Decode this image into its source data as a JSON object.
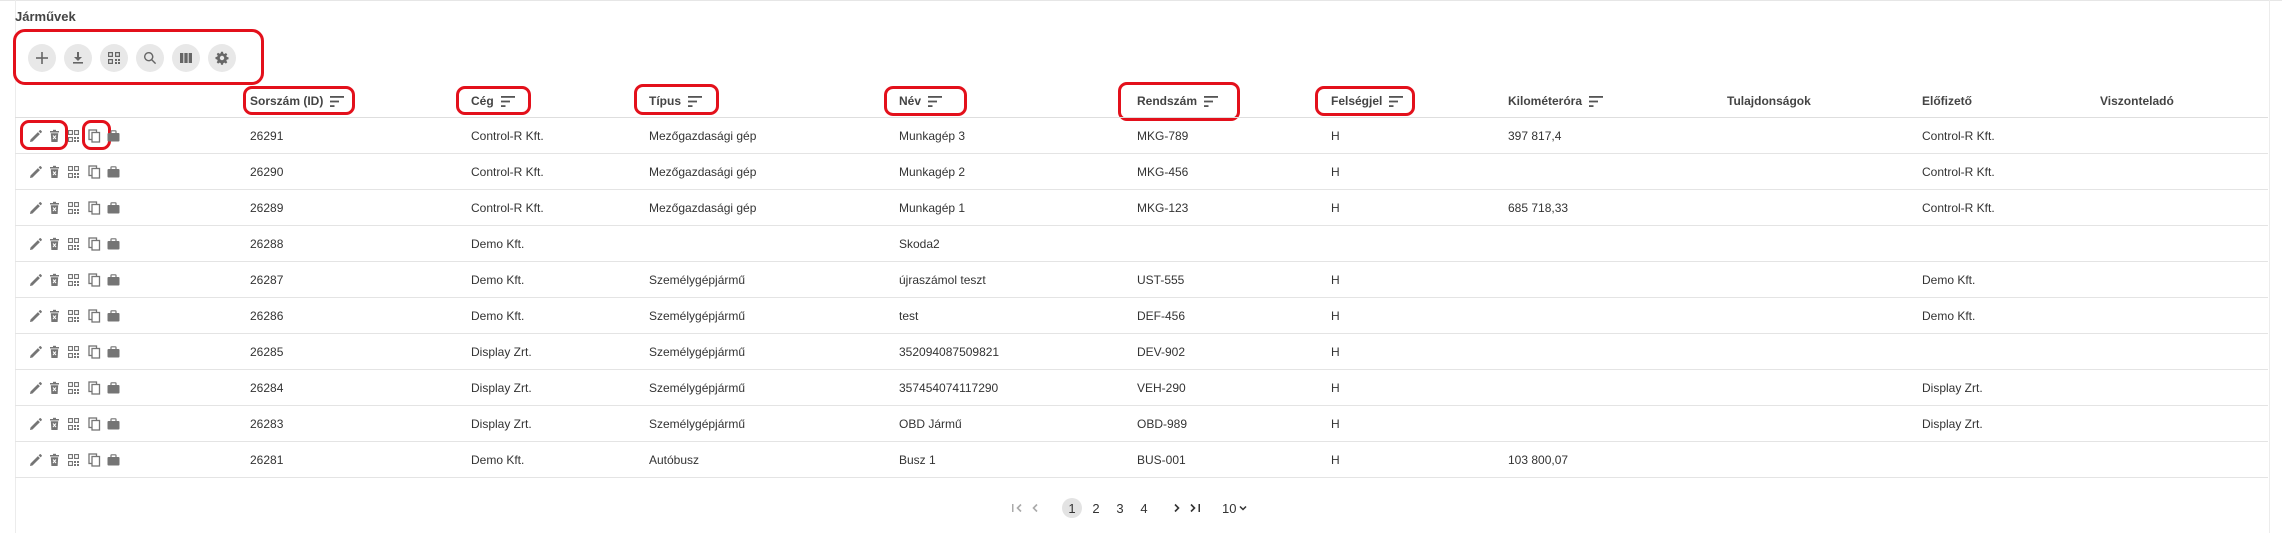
{
  "page": {
    "title": "Járművek"
  },
  "toolbar": {
    "buttons": [
      {
        "name": "add-button",
        "icon": "plus-icon"
      },
      {
        "name": "download-button",
        "icon": "download-icon"
      },
      {
        "name": "qr-button",
        "icon": "qr-code-icon"
      },
      {
        "name": "search-button",
        "icon": "search-icon"
      },
      {
        "name": "columns-button",
        "icon": "view-columns-icon"
      },
      {
        "name": "settings-button",
        "icon": "gear-icon"
      }
    ]
  },
  "columns": {
    "id": "Sorszám (ID)",
    "company": "Cég",
    "type": "Típus",
    "name": "Név",
    "plate": "Rendszám",
    "country": "Felségjel",
    "odometer": "Kilométeróra",
    "properties": "Tulajdonságok",
    "subscriber": "Előfizető",
    "reseller": "Viszonteladó"
  },
  "rows": [
    {
      "id": "26291",
      "company": "Control-R Kft.",
      "type": "Mezőgazdasági gép",
      "name": "Munkagép 3",
      "plate": "MKG-789",
      "country": "H",
      "odometer": "397 817,4",
      "properties": "",
      "subscriber": "Control-R Kft.",
      "reseller": ""
    },
    {
      "id": "26290",
      "company": "Control-R Kft.",
      "type": "Mezőgazdasági gép",
      "name": "Munkagép 2",
      "plate": "MKG-456",
      "country": "H",
      "odometer": "",
      "properties": "",
      "subscriber": "Control-R Kft.",
      "reseller": ""
    },
    {
      "id": "26289",
      "company": "Control-R Kft.",
      "type": "Mezőgazdasági gép",
      "name": "Munkagép 1",
      "plate": "MKG-123",
      "country": "H",
      "odometer": "685 718,33",
      "properties": "",
      "subscriber": "Control-R Kft.",
      "reseller": ""
    },
    {
      "id": "26288",
      "company": "Demo Kft.",
      "type": "",
      "name": "Skoda2",
      "plate": "",
      "country": "",
      "odometer": "",
      "properties": "",
      "subscriber": "",
      "reseller": ""
    },
    {
      "id": "26287",
      "company": "Demo Kft.",
      "type": "Személygépjármű",
      "name": "újraszámol teszt",
      "plate": "UST-555",
      "country": "H",
      "odometer": "",
      "properties": "",
      "subscriber": "Demo Kft.",
      "reseller": ""
    },
    {
      "id": "26286",
      "company": "Demo Kft.",
      "type": "Személygépjármű",
      "name": "test",
      "plate": "DEF-456",
      "country": "H",
      "odometer": "",
      "properties": "",
      "subscriber": "Demo Kft.",
      "reseller": ""
    },
    {
      "id": "26285",
      "company": "Display Zrt.",
      "type": "Személygépjármű",
      "name": "352094087509821",
      "plate": "DEV-902",
      "country": "H",
      "odometer": "",
      "properties": "",
      "subscriber": "",
      "reseller": ""
    },
    {
      "id": "26284",
      "company": "Display Zrt.",
      "type": "Személygépjármű",
      "name": "357454074117290",
      "plate": "VEH-290",
      "country": "H",
      "odometer": "",
      "properties": "",
      "subscriber": "Display Zrt.",
      "reseller": ""
    },
    {
      "id": "26283",
      "company": "Display Zrt.",
      "type": "Személygépjármű",
      "name": "OBD Jármű",
      "plate": "OBD-989",
      "country": "H",
      "odometer": "",
      "properties": "",
      "subscriber": "Display Zrt.",
      "reseller": ""
    },
    {
      "id": "26281",
      "company": "Demo Kft.",
      "type": "Autóbusz",
      "name": "Busz 1",
      "plate": "BUS-001",
      "country": "H",
      "odometer": "103 800,07",
      "properties": "",
      "subscriber": "",
      "reseller": ""
    }
  ],
  "row_actions": [
    "pencil-icon",
    "trash-icon",
    "qr-code-icon",
    "copy-icon",
    "briefcase-icon"
  ],
  "pagination": {
    "pages": [
      "1",
      "2",
      "3",
      "4"
    ],
    "current": "1",
    "page_size": "10"
  },
  "colors": {
    "highlight": "#e3101b",
    "icon": "#757575",
    "button_bg": "#e8e8e8"
  }
}
